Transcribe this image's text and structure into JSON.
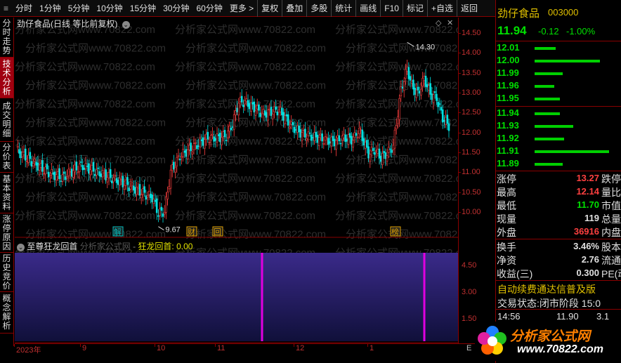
{
  "toolbar": {
    "items": [
      "分时",
      "1分钟",
      "5分钟",
      "10分钟",
      "15分钟",
      "30分钟",
      "60分钟",
      "更多 >",
      "复权",
      "叠加",
      "多股",
      "统计",
      "画线",
      "F10",
      "标记",
      "+自选",
      "返回"
    ]
  },
  "side_tabs": [
    "分时走势",
    "技术分析",
    "成交明细",
    "分价表",
    "基本资料",
    "涨停原因",
    "历史竞价",
    "概念解析"
  ],
  "chart": {
    "title": "劲仔食品(日线 等比前复权)",
    "watermark": "分析家公式网www.70822.com",
    "high_label": "14.30",
    "low_label": "9.67",
    "markers": [
      "解",
      "财",
      "回",
      "榜"
    ],
    "price_axis": [
      "14.50",
      "14.00",
      "13.50",
      "13.00",
      "12.50",
      "12.00",
      "11.50",
      "11.00",
      "10.50",
      "10.00"
    ]
  },
  "indicator": {
    "name": "至尊狂龙回首",
    "source": "分析家公式网",
    "sep": "-",
    "line_label": "狂龙回首: 0.00",
    "axis": [
      "4.50",
      "3.00",
      "1.50"
    ]
  },
  "time_axis": [
    "2023年",
    "9",
    "10",
    "11",
    "12",
    "1"
  ],
  "time_axis_end": "E",
  "quote": {
    "name": "劲仔食品",
    "code": "003000",
    "price": "11.94",
    "change": "-0.12",
    "pct": "-1.00%",
    "asks": [
      {
        "price": "12.01",
        "vol": 0.28
      },
      {
        "price": "12.00",
        "vol": 0.88
      },
      {
        "price": "11.99",
        "vol": 0.38
      },
      {
        "price": "11.96",
        "vol": 0.26
      },
      {
        "price": "11.95",
        "vol": 0.34
      }
    ],
    "bids": [
      {
        "price": "11.94",
        "vol": 0.34
      },
      {
        "price": "11.93",
        "vol": 0.52
      },
      {
        "price": "11.92",
        "vol": 0.4
      },
      {
        "price": "11.91",
        "vol": 1.0
      },
      {
        "price": "11.89",
        "vol": 0.38
      }
    ],
    "stats": [
      {
        "l1": "涨停",
        "v": "13.27",
        "c": "#ff4040",
        "l2": "跌停"
      },
      {
        "l1": "最高",
        "v": "12.14",
        "c": "#ff4040",
        "l2": "量比"
      },
      {
        "l1": "最低",
        "v": "11.70",
        "c": "#00e000",
        "l2": "市值"
      },
      {
        "l1": "现量",
        "v": "119",
        "c": "#e0e0e0",
        "l2": "总量"
      },
      {
        "l1": "外盘",
        "v": "36916",
        "c": "#ff4040",
        "l2": "内盘"
      }
    ],
    "stats2": [
      {
        "l1": "换手",
        "v": "3.46%",
        "c": "#e0e0e0",
        "l2": "股本"
      },
      {
        "l1": "净资",
        "v": "2.76",
        "c": "#e0e0e0",
        "l2": "流通"
      },
      {
        "l1": "收益(三)",
        "v": "0.300",
        "c": "#e0e0e0",
        "l2": "PE(动)"
      }
    ],
    "ad_text": "自动续费通达信普及版",
    "status_label": "交易状态:",
    "status_value": "闭市阶段",
    "status_time": "15:0",
    "tick_time": "14:56",
    "tick_price": "11.90",
    "tick_vol": "3.1"
  },
  "logo": {
    "title": "分析家公式网",
    "url": "www.70822.com"
  },
  "colors": {
    "up": "#ff4040",
    "down": "#00e0e0",
    "grid": "#8a0000",
    "signal": "#e000e0"
  }
}
